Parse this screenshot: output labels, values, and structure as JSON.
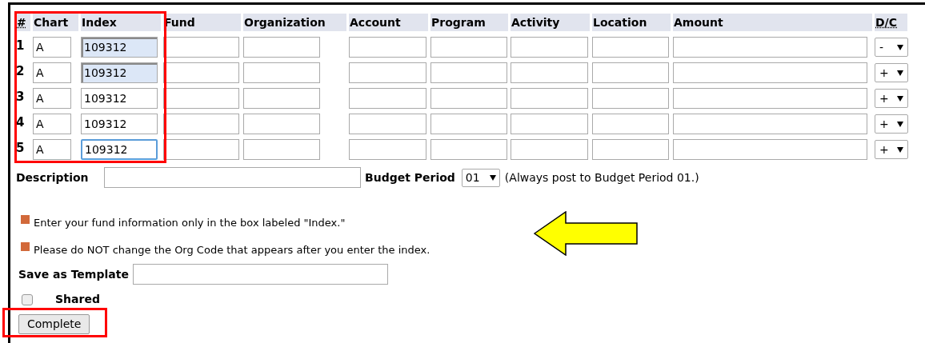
{
  "columns": [
    "#",
    "Chart",
    "Index",
    "Fund",
    "Organization",
    "Account",
    "Program",
    "Activity",
    "Location",
    "Amount",
    "D/C"
  ],
  "rows": [
    {
      "number": "1",
      "chart": "A",
      "index": "109312",
      "index_autofilled": true,
      "index_focused": false,
      "dc": "-"
    },
    {
      "number": "2",
      "chart": "A",
      "index": "109312",
      "index_autofilled": true,
      "index_focused": false,
      "dc": "+"
    },
    {
      "number": "3",
      "chart": "A",
      "index": "109312",
      "index_autofilled": false,
      "index_focused": false,
      "dc": "+"
    },
    {
      "number": "4",
      "chart": "A",
      "index": "109312",
      "index_autofilled": false,
      "index_focused": false,
      "dc": "+"
    },
    {
      "number": "5",
      "chart": "A",
      "index": "109312",
      "index_autofilled": false,
      "index_focused": true,
      "dc": "+"
    }
  ],
  "description": {
    "label": "Description"
  },
  "budget_period": {
    "label": "Budget Period",
    "value": "01",
    "note": "(Always post to Budget Period 01.)"
  },
  "notes": [
    "Enter your fund information only in the box labeled \"Index.\"",
    "Please do NOT change the Org Code that appears after you enter the index."
  ],
  "template": {
    "label": "Save as Template"
  },
  "shared": {
    "label": "Shared",
    "checked": false
  },
  "complete_button": "Complete"
}
